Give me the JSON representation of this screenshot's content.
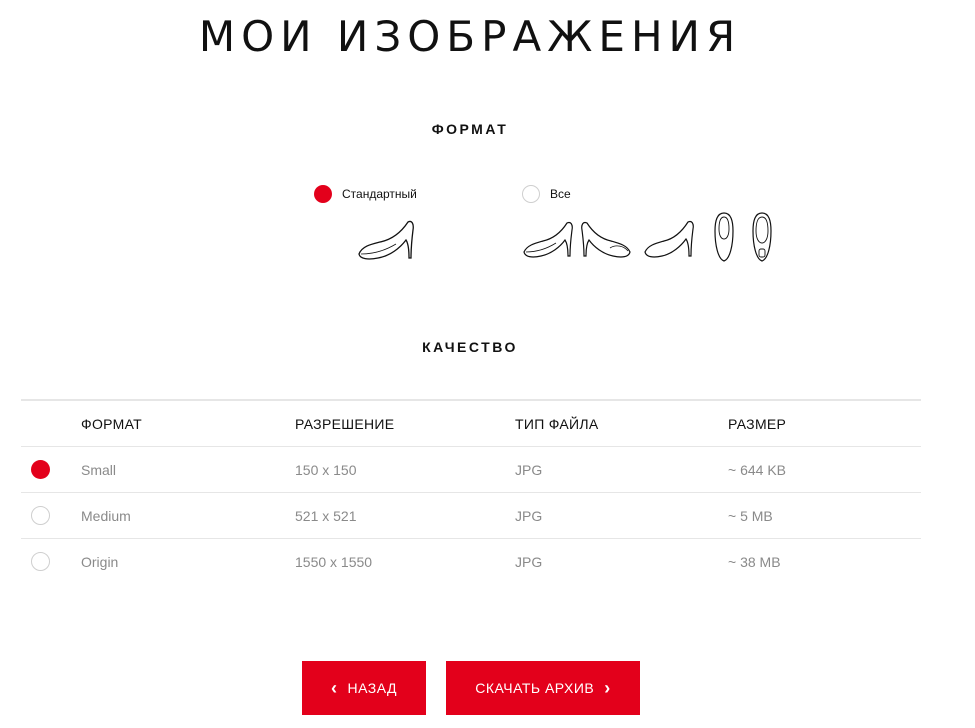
{
  "header": {
    "title": "МОИ ИЗОБРАЖЕНИЯ"
  },
  "format": {
    "heading": "ФОРМАТ",
    "options": [
      {
        "label": "Стандартный",
        "selected": true,
        "icons": [
          "shoe-side-icon"
        ]
      },
      {
        "label": "Все",
        "selected": false,
        "icons": [
          "shoe-side-icon",
          "shoe-front-side-icon",
          "shoe-side-right-icon",
          "shoe-top-icon",
          "shoe-sole-icon"
        ]
      }
    ]
  },
  "quality": {
    "heading": "КАЧЕСТВО",
    "columns": [
      "ФОРМАТ",
      "РАЗРЕШЕНИЕ",
      "ТИП ФАЙЛА",
      "РАЗМЕР"
    ],
    "rows": [
      {
        "format": "Small",
        "resolution": "150 x 150",
        "type": "JPG",
        "size": "~ 644 KB",
        "selected": true
      },
      {
        "format": "Medium",
        "resolution": "521 x 521",
        "type": "JPG",
        "size": "~ 5 MB",
        "selected": false
      },
      {
        "format": "Origin",
        "resolution": "1550 x 1550",
        "type": "JPG",
        "size": "~ 38 MB",
        "selected": false
      }
    ]
  },
  "buttons": {
    "back_label": "НАЗАД",
    "download_label": "СКАЧАТЬ АРХИВ"
  },
  "colors": {
    "accent": "#e3001b",
    "divider": "#e6e6e6",
    "muted_text": "#8a8a8a"
  }
}
